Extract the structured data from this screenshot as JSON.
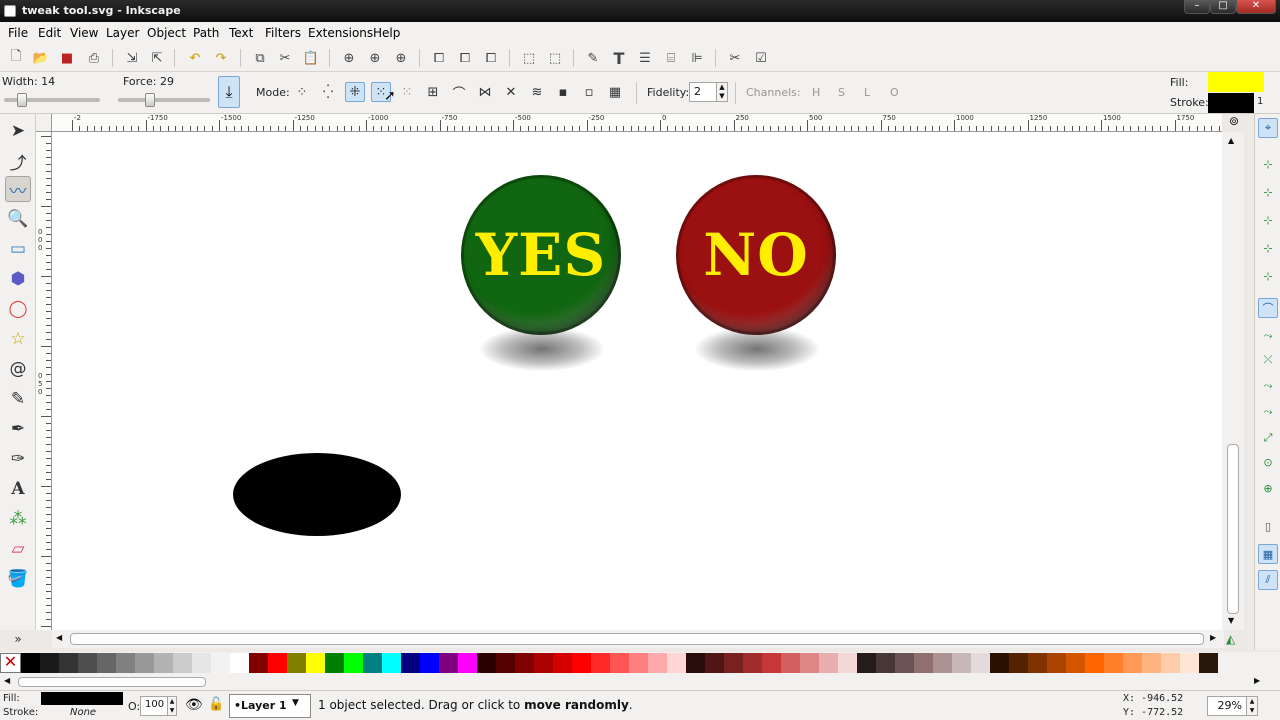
{
  "window": {
    "title": "tweak tool.svg - Inkscape"
  },
  "menu": [
    "File",
    "Edit",
    "View",
    "Layer",
    "Object",
    "Path",
    "Text",
    "Filters",
    "Extensions",
    "Help"
  ],
  "controls": {
    "width_label": "Width: 14",
    "force_label": "Force: 29",
    "mode_label": "Mode:",
    "fidelity_label": "Fidelity:",
    "fidelity_value": "2",
    "channels_label": "Channels:",
    "channels": [
      "H",
      "S",
      "L",
      "O"
    ],
    "width_level": 0.14,
    "force_level": 0.29
  },
  "style_indicator": {
    "fill_label": "Fill:",
    "stroke_label": "Stroke:",
    "fill_color": "#ffff00",
    "stroke_color": "#000000",
    "stroke_width": "1"
  },
  "ruler": {
    "h_labels": [
      "-2",
      "-1750",
      "-1500",
      "-1250",
      "-1000",
      "-750",
      "-500",
      "-250",
      "0",
      "250",
      "500",
      "750",
      "1000",
      "1250",
      "1500",
      "1750"
    ],
    "v_labels": [
      "0",
      "0",
      "0",
      "0",
      "5",
      "0"
    ]
  },
  "canvas": {
    "yes_button": {
      "label": "YES",
      "color": "#116611"
    },
    "no_button": {
      "label": "NO",
      "color": "#9b1010"
    },
    "text_color": "#ffee00"
  },
  "palette": [
    "#000000",
    "#1a1a1a",
    "#333333",
    "#4d4d4d",
    "#666666",
    "#808080",
    "#999999",
    "#b3b3b3",
    "#cccccc",
    "#e6e6e6",
    "#f2f2f2",
    "#ffffff",
    "#800000",
    "#ff0000",
    "#808000",
    "#ffff00",
    "#008000",
    "#00ff00",
    "#008080",
    "#00ffff",
    "#000080",
    "#0000ff",
    "#800080",
    "#ff00ff",
    "#2b0000",
    "#550000",
    "#800000",
    "#aa0000",
    "#d40000",
    "#ff0000",
    "#ff2a2a",
    "#ff5555",
    "#ff8080",
    "#ffaaaa",
    "#ffd5d5",
    "#280b0b",
    "#501616",
    "#782121",
    "#a02c2c",
    "#c83737",
    "#d35f5f",
    "#de8787",
    "#e9afaf",
    "#f4d7d7",
    "#241c1c",
    "#483737",
    "#6c5353",
    "#916f6f",
    "#ac9393",
    "#c8b7b7",
    "#e3dbdb",
    "#2b1100",
    "#552200",
    "#803300",
    "#aa4400",
    "#d45500",
    "#ff6600",
    "#ff7f2a",
    "#ff9955",
    "#ffb380",
    "#ffccaa",
    "#ffe6d5",
    "#28170b"
  ],
  "status": {
    "fill_label": "Fill:",
    "stroke_label": "Stroke:",
    "stroke_value": "None",
    "opacity_label": "O:",
    "opacity_value": "100",
    "layer": "•Layer 1",
    "message_prefix": "1 object selected. Drag or click to ",
    "message_bold": "move randomly",
    "message_suffix": ".",
    "x_coord": "X: -946.52",
    "y_coord": "Y: -772.52",
    "zoom": "29%"
  }
}
